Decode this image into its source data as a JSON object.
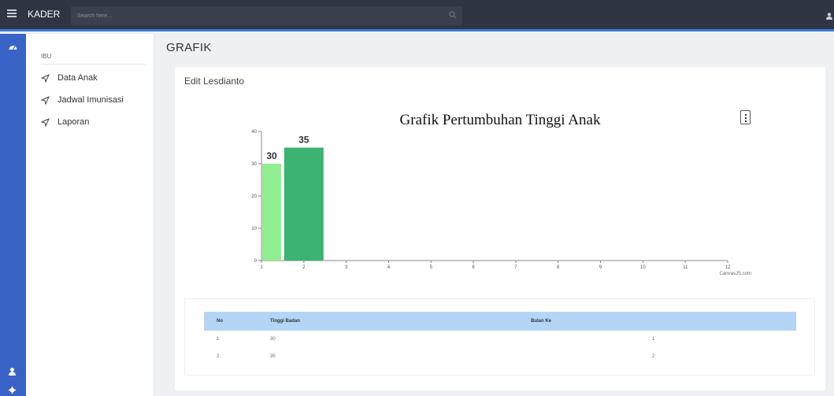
{
  "topbar": {
    "brand": "KADER",
    "search_placeholder": "Search here..."
  },
  "sidebar": {
    "header": "IBU",
    "items": [
      {
        "label": "Data Anak",
        "icon": "send-icon"
      },
      {
        "label": "Jadwal Imunisasi",
        "icon": "send-icon"
      },
      {
        "label": "Laporan",
        "icon": "send-icon"
      }
    ]
  },
  "page": {
    "title": "GRAFIK",
    "card_title": "Edit Lesdianto"
  },
  "chart_data": {
    "type": "bar",
    "title": "Grafik Pertumbuhan Tinggi Anak",
    "x": [
      1,
      2
    ],
    "values": [
      30,
      35
    ],
    "data_labels": [
      "30",
      "35"
    ],
    "xlim": [
      1,
      12
    ],
    "ylim": [
      0,
      40
    ],
    "xticks": [
      "1",
      "2",
      "3",
      "4",
      "5",
      "6",
      "7",
      "8",
      "9",
      "10",
      "11",
      "12"
    ],
    "yticks": [
      "0",
      "10",
      "20",
      "30",
      "40"
    ],
    "bar_colors": [
      "#90ee90",
      "#3cb371"
    ],
    "credit": "CanvasJS.com",
    "grid": false
  },
  "table": {
    "headers": [
      "No",
      "Tinggi Badan",
      "Bulan Ke"
    ],
    "rows": [
      [
        "1",
        "30",
        "1"
      ],
      [
        "2",
        "35",
        "2"
      ]
    ]
  }
}
